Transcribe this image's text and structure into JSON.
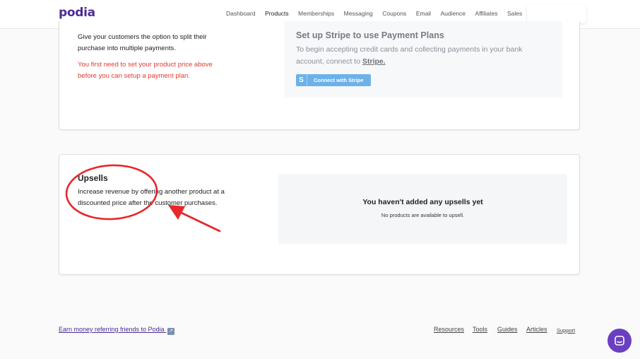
{
  "header": {
    "logo": "podia",
    "nav": [
      {
        "label": "Dashboard",
        "active": false
      },
      {
        "label": "Products",
        "active": true
      },
      {
        "label": "Memberships",
        "active": false
      },
      {
        "label": "Messaging",
        "active": false
      },
      {
        "label": "Coupons",
        "active": false
      },
      {
        "label": "Email",
        "active": false
      },
      {
        "label": "Audience",
        "active": false
      },
      {
        "label": "Affiliates",
        "active": false
      },
      {
        "label": "Sales",
        "active": false
      }
    ]
  },
  "payment_plans": {
    "description": "Give your customers the option to split their purchase into multiple payments.",
    "warning": "You first need to set your product price above before you can setup a payment plan.",
    "stripe_title": "Set up Stripe to use Payment Plans",
    "stripe_text": "To begin accepting credit cards and collecting payments in your bank account, connect to",
    "stripe_link": "Stripe.",
    "stripe_button_icon": "S",
    "stripe_button": "Connect with Stripe"
  },
  "upsells": {
    "title": "Upsells",
    "description": "Increase revenue by offering another product at a discounted price after the customer purchases.",
    "empty_title": "You haven't added any upsells yet",
    "empty_subtitle": "No products are available to upsell."
  },
  "footer": {
    "referral": "Earn money referring friends to Podia",
    "links": [
      "Resources",
      "Tools",
      "Guides",
      "Articles",
      "Support"
    ]
  },
  "colors": {
    "brand": "#4b2c92",
    "warning": "#e03b2e",
    "annotation": "#e8272a",
    "stripe_button": "#6cb2ea",
    "chat": "#6b3fc1"
  },
  "icons": {
    "external": "external-link-icon",
    "chat": "chat-icon",
    "stripe": "stripe-s-icon"
  }
}
